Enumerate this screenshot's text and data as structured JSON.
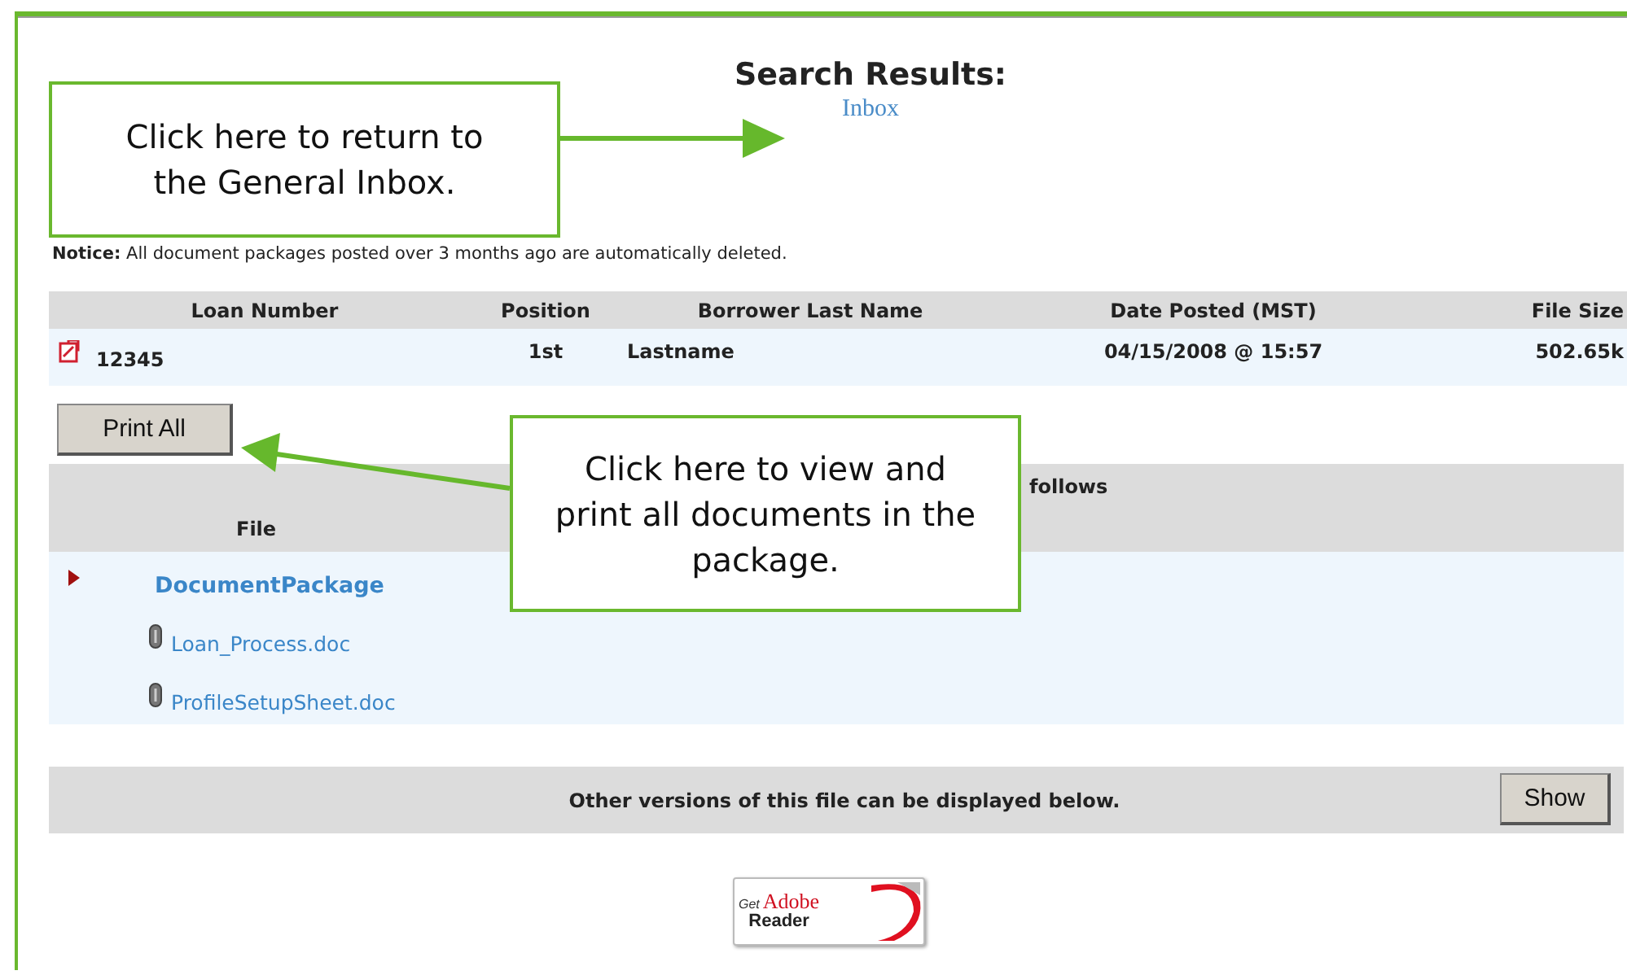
{
  "title": "Search Results:",
  "inbox_link": "Inbox",
  "notice": {
    "label": "Notice:",
    "text": "All document packages posted over 3 months ago are automatically deleted."
  },
  "loans_table": {
    "columns": [
      "Loan Number",
      "Position",
      "Borrower Last Name",
      "Date Posted (MST)",
      "File Size"
    ],
    "rows": [
      {
        "loan_number": "12345",
        "position": "1st",
        "borrower": "Lastname",
        "date_posted": "04/15/2008 @ 15:57",
        "file_size": "502.65k"
      }
    ]
  },
  "print_all_button": "Print All",
  "files_table": {
    "caption_fragment": "follows",
    "column": "File",
    "package": "DocumentPackage",
    "files": [
      "Loan_Process.doc",
      "ProfileSetupSheet.doc"
    ]
  },
  "versions_bar": {
    "text": "Other versions of this file can be displayed below.",
    "button": "Show"
  },
  "adobe_badge": {
    "get": "Get",
    "brand": "Adobe",
    "product": "Reader"
  },
  "callouts": [
    {
      "text": "Click here to return to the General Inbox."
    },
    {
      "text": "Click here to view and print all documents in the package."
    }
  ]
}
